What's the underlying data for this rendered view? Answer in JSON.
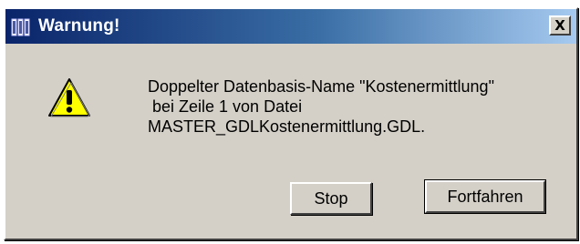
{
  "window": {
    "title": "Warnung!",
    "close_label": "X"
  },
  "icons": {
    "app": "app-columns-icon",
    "warning": "warning-triangle-icon",
    "warning_color": "#ffff00"
  },
  "message": {
    "lines": [
      "Doppelter Datenbasis-Name \"Kostenermittlung\"",
      " bei Zeile 1 von Datei",
      "MASTER_GDLKostenermittlung.GDL."
    ]
  },
  "buttons": {
    "stop_label": "Stop",
    "continue_label": "Fortfahren"
  },
  "colors": {
    "titlebar_start": "#0a246a",
    "titlebar_end": "#a6caf0",
    "dialog_face": "#d4d0c8"
  }
}
